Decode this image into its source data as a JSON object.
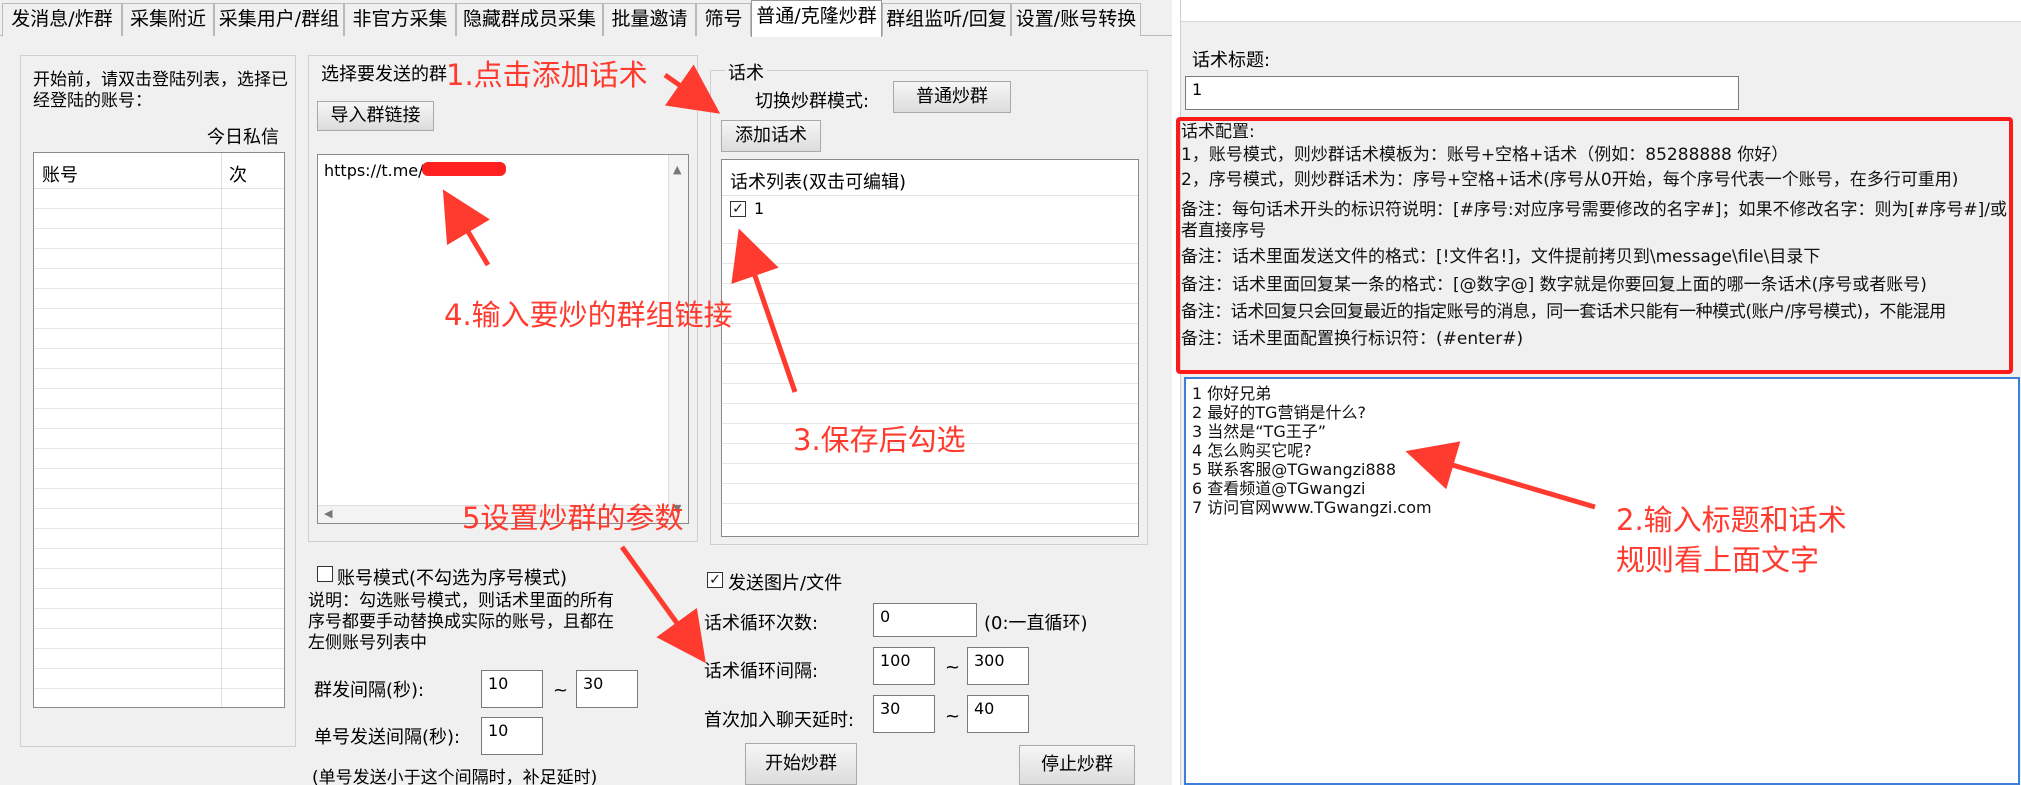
{
  "tabs": [
    {
      "label": "发消息/炸群",
      "active": false
    },
    {
      "label": "采集附近",
      "active": false
    },
    {
      "label": "采集用户/群组",
      "active": false
    },
    {
      "label": "非官方采集",
      "active": false
    },
    {
      "label": "隐藏群成员采集",
      "active": false
    },
    {
      "label": "批量邀请",
      "active": false
    },
    {
      "label": "筛号",
      "active": false
    },
    {
      "label": "普通/克隆炒群",
      "active": true
    },
    {
      "label": "群组监听/回复",
      "active": false
    },
    {
      "label": "设置/账号转换",
      "active": false
    }
  ],
  "accounts": {
    "hint": "开始前，请双击登陆列表，选择已经登陆的账号：",
    "today_dm": "今日私信",
    "col_account": "账号",
    "col_count": "次"
  },
  "group_select": {
    "title": "选择要发送的群",
    "import_button": "导入群链接",
    "link_text": "https://t.me/"
  },
  "script_panel": {
    "title": "话术",
    "mode_label": "切换炒群模式:",
    "mode_button": "普通炒群",
    "add_button": "添加话术",
    "list_header": "话术列表(双击可编辑)",
    "items": [
      {
        "label": "1",
        "checked": true
      }
    ]
  },
  "options": {
    "account_mode_label": "账号模式(不勾选为序号模式)",
    "account_mode_checked": false,
    "note": "说明：勾选账号模式，则话术里面的所有序号都要手动替换成实际的账号，且都在左侧账号列表中",
    "group_interval_label": "群发间隔(秒):",
    "group_interval_min": "10",
    "group_interval_max": "30",
    "single_interval_label": "单号发送间隔(秒):",
    "single_interval_value": "10",
    "single_interval_note": "(单号发送小于这个间隔时，补足延时)",
    "tilde": "~",
    "send_media_label": "发送图片/文件",
    "send_media_checked": true,
    "loop_count_label": "话术循环次数:",
    "loop_count_value": "0",
    "loop_count_note": "(0:一直循环)",
    "loop_interval_label": "话术循环间隔:",
    "loop_interval_min": "100",
    "loop_interval_max": "300",
    "join_delay_label": "首次加入聊天延时:",
    "join_delay_min": "30",
    "join_delay_max": "40",
    "start_button": "开始炒群",
    "stop_button": "停止炒群"
  },
  "editor": {
    "title_label": "话术标题:",
    "title_value": "1",
    "config_lines": [
      "话术配置:",
      "1，账号模式，则炒群话术模板为：账号+空格+话术（例如：85288888 你好）",
      "2，序号模式，则炒群话术为：序号+空格+话术(序号从0开始，每个序号代表一个账号，在多行可重用)",
      "备注：每句话术开头的标识符说明：[#序号:对应序号需要修改的名字#]；如果不修改名字：则为[#序号#]/或者直接序号",
      "备注：话术里面发送文件的格式：[!文件名!]，文件提前拷贝到\\message\\file\\目录下",
      "备注：话术里面回复某一条的格式：[@数字@] 数字就是你要回复上面的哪一条话术(序号或者账号)",
      "备注：话术回复只会回复最近的指定账号的消息，同一套话术只能有一种模式(账户/序号模式)，不能混用",
      "备注：话术里面配置换行标识符：(#enter#)"
    ],
    "content_lines": [
      "1 你好兄弟",
      "2 最好的TG营销是什么?",
      "3 当然是“TG王子”",
      "4 怎么购买它呢?",
      "5 联系客服@TGwangzi888",
      "6 查看频道@TGwangzi",
      "7 访问官网www.TGwangzi.com"
    ]
  },
  "annotations": {
    "step1": "1.点击添加话术",
    "step2_line1": "2.输入标题和话术",
    "step2_line2": "规则看上面文字",
    "step3": "3.保存后勾选",
    "step4": "4.输入要炒的群组链接",
    "step5": "5设置炒群的参数"
  },
  "colors": {
    "annotation_red": "#ff3b2f",
    "highlight_border": "#ff1a1a",
    "window_bg": "#f0f0f0"
  }
}
